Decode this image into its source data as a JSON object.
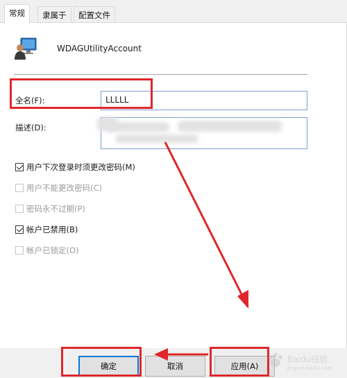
{
  "tabs": [
    {
      "label": "常规",
      "active": true
    },
    {
      "label": "隶属于",
      "active": false
    },
    {
      "label": "配置文件",
      "active": false
    }
  ],
  "account": {
    "name": "WDAGUtilityAccount"
  },
  "fields": {
    "fullname_label": "全名(F):",
    "fullname_value": "LLLLL",
    "description_label": "描述(D):"
  },
  "checkboxes": [
    {
      "label": "用户下次登录时须更改密码(M)",
      "checked": true,
      "enabled": true
    },
    {
      "label": "用户不能更改密码(C)",
      "checked": false,
      "enabled": false
    },
    {
      "label": "密码永不过期(P)",
      "checked": false,
      "enabled": false
    },
    {
      "label": "帐户已禁用(B)",
      "checked": true,
      "enabled": true
    },
    {
      "label": "帐户已锁定(O)",
      "checked": false,
      "enabled": false
    }
  ],
  "buttons": {
    "ok": "确定",
    "cancel": "取消",
    "apply": "应用(A)"
  },
  "watermark": {
    "text": "Baidu经验",
    "sub": "jingyan.baidu.com"
  },
  "colors": {
    "annotation": "#e0262a",
    "focus": "#0078d7"
  }
}
